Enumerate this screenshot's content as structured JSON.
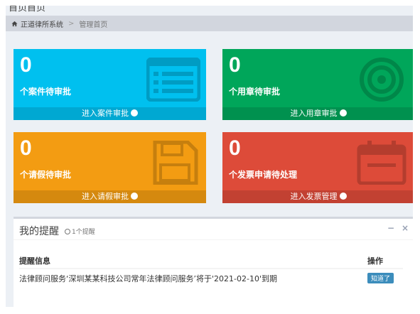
{
  "page": {
    "title": "首页首页"
  },
  "breadcrumb": {
    "home": "正道律所系统",
    "separator": ">",
    "current": "管理首页"
  },
  "boxes": [
    {
      "count": "0",
      "label": "个案件待审批",
      "link": "进入案件审批",
      "color": "#00c0ef",
      "icon": "list-icon"
    },
    {
      "count": "0",
      "label": "个用章待审批",
      "link": "进入用章审批",
      "color": "#00a65a",
      "icon": "target-icon"
    },
    {
      "count": "0",
      "label": "个请假待审批",
      "link": "进入请假审批",
      "color": "#f39c12",
      "icon": "save-icon"
    },
    {
      "count": "0",
      "label": "个发票申请待处理",
      "link": "进入发票管理",
      "color": "#dd4b39",
      "icon": "calendar-icon"
    }
  ],
  "reminders": {
    "title": "我的提醒",
    "count_text": "1个提醒",
    "tools": {
      "collapse": "−",
      "close": "×"
    },
    "columns": {
      "info": "提醒信息",
      "action": "操作"
    },
    "rows": [
      {
        "info": "法律顾问服务‘深圳某某科技公司常年法律顾问服务’将于'2021-02-10'到期",
        "action": "知道了"
      }
    ]
  }
}
